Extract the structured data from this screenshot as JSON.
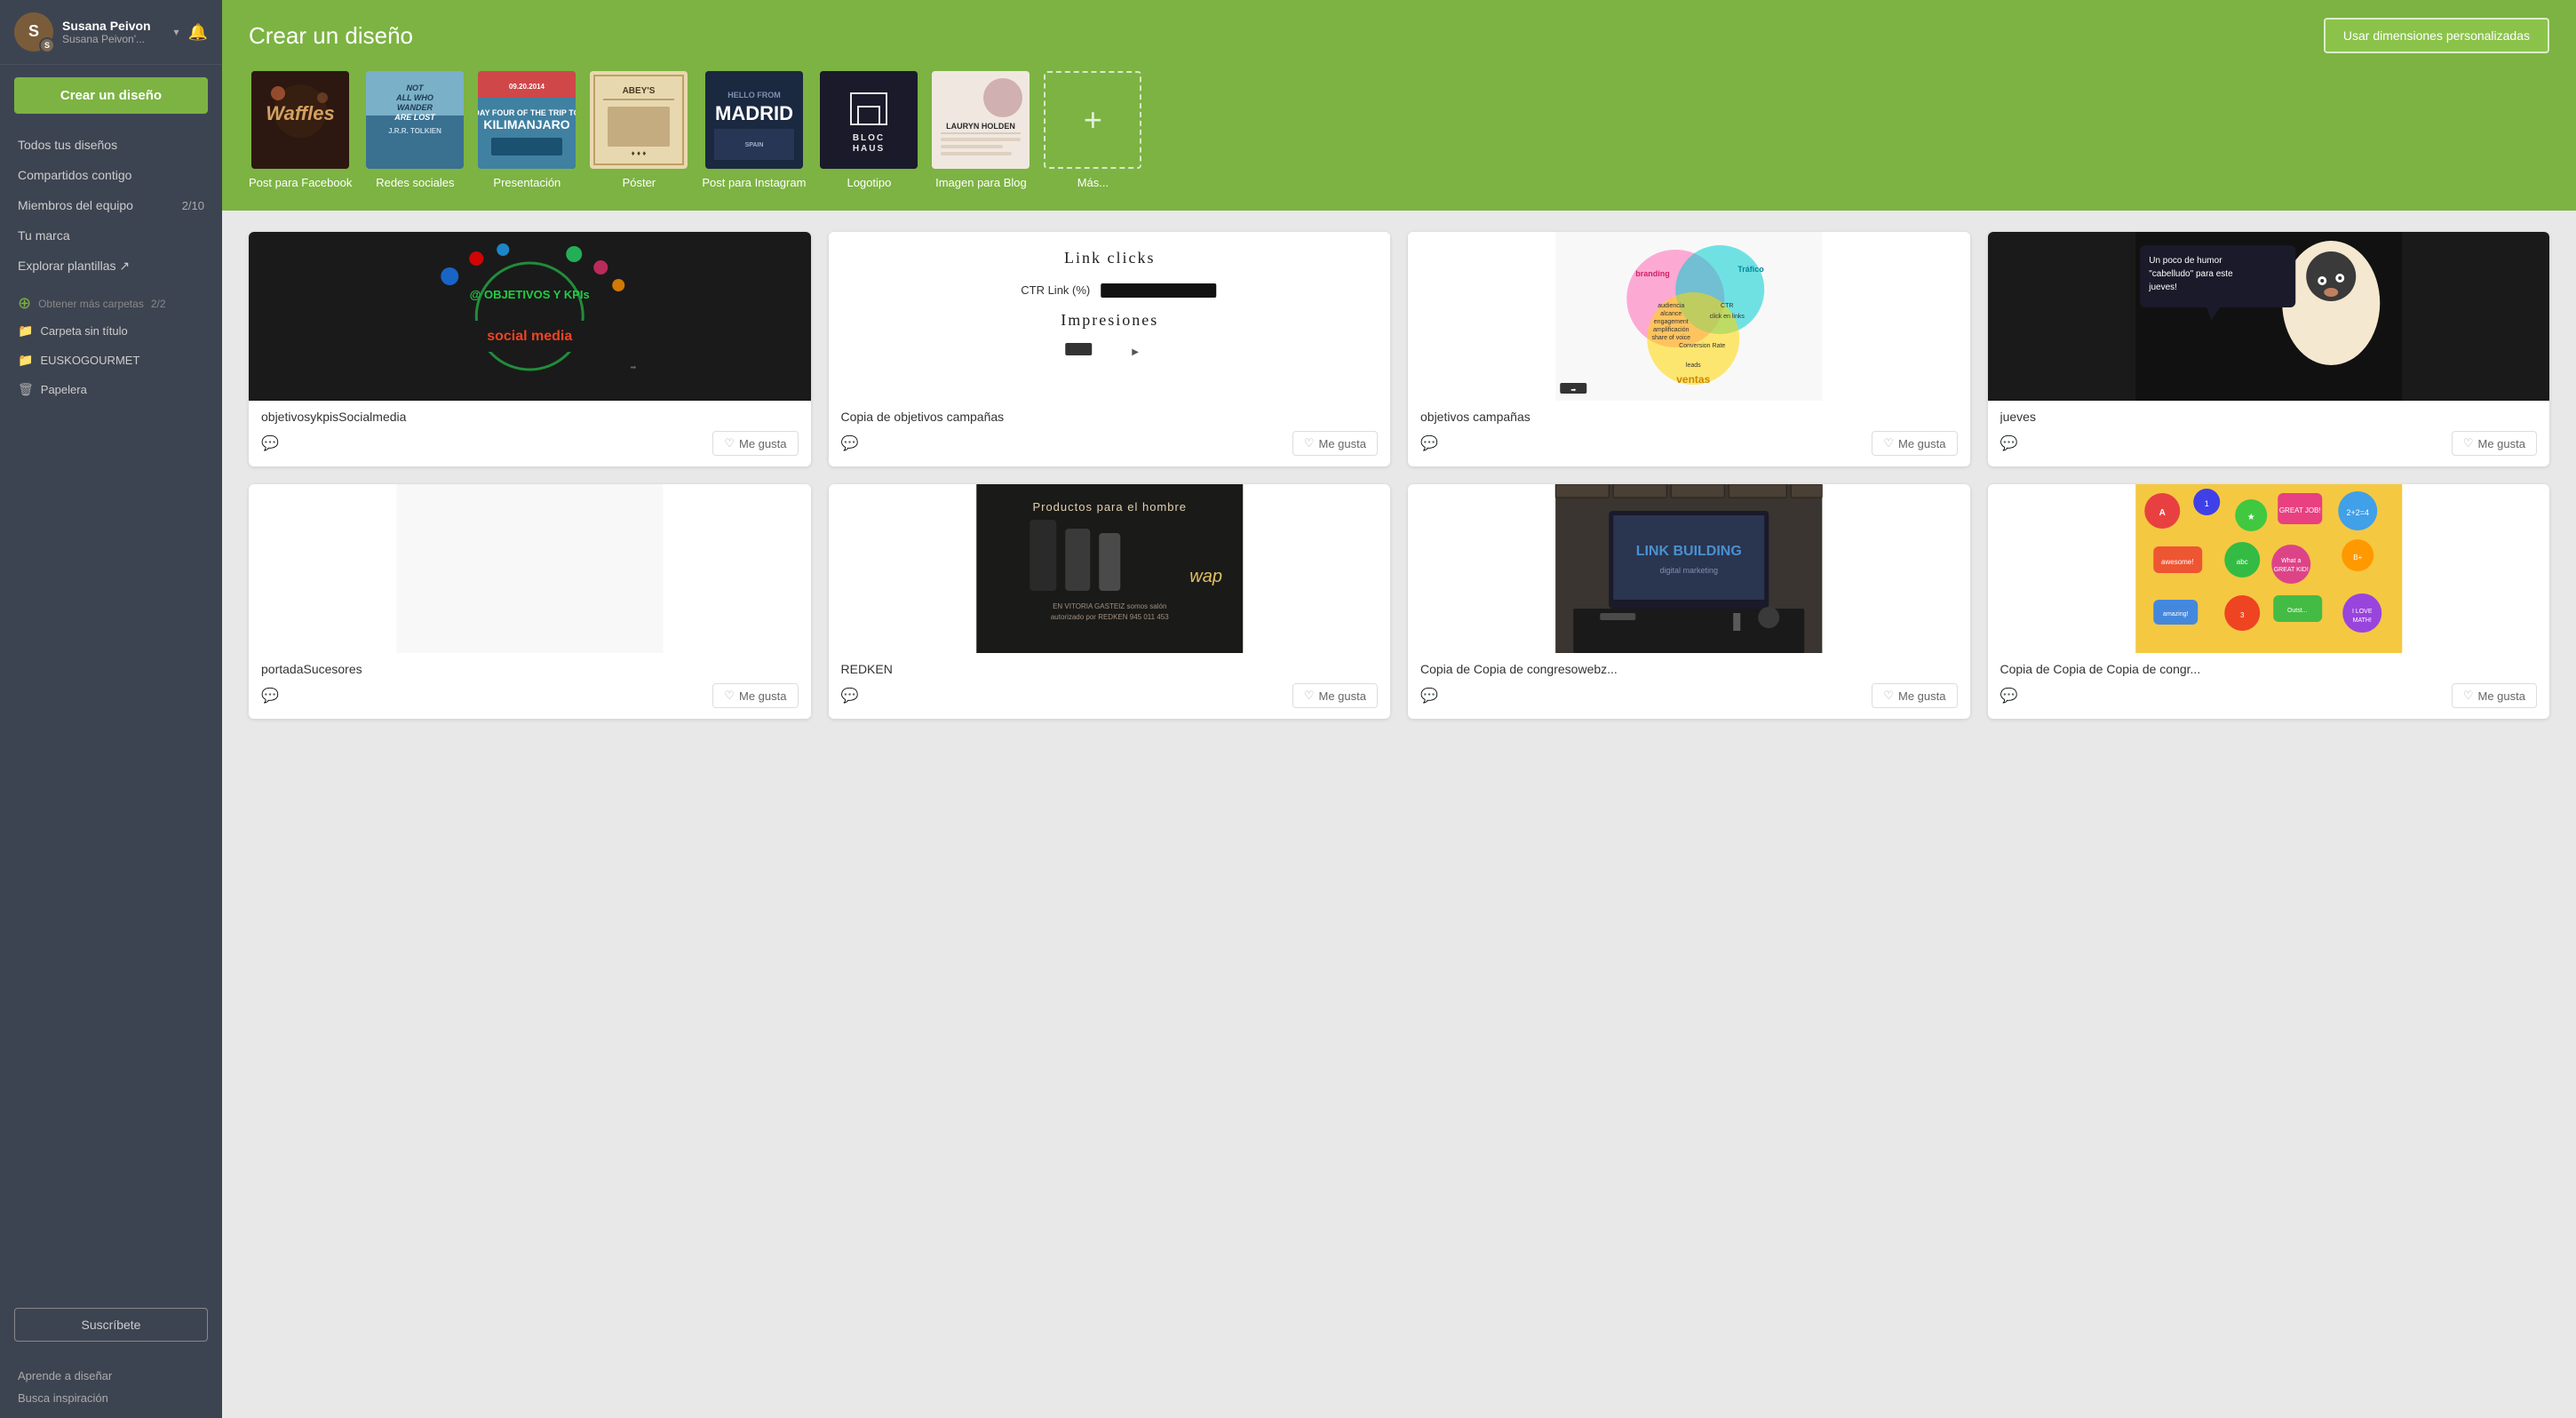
{
  "sidebar": {
    "user": {
      "name": "Susana Peivon",
      "sub": "Susana Peivon'...",
      "avatar_letter": "S"
    },
    "create_label": "Crear un diseño",
    "nav_items": [
      {
        "id": "all-designs",
        "label": "Todos tus diseños",
        "count": null,
        "badge": null
      },
      {
        "id": "shared",
        "label": "Compartidos contigo",
        "count": null,
        "badge": null
      },
      {
        "id": "team-members",
        "label": "Miembros del equipo",
        "count": "2/10",
        "badge": null
      },
      {
        "id": "brand",
        "label": "Tu marca",
        "count": null,
        "badge": null
      },
      {
        "id": "explore",
        "label": "Explorar plantillas ↗",
        "count": null,
        "badge": null
      }
    ],
    "folders_section_label": "Obtener más carpetas",
    "folders_badge": "2/2",
    "folders": [
      {
        "id": "untitled",
        "label": "Carpeta sin título",
        "icon": "folder"
      },
      {
        "id": "euskogourmet",
        "label": "EUSKOGOURMET",
        "icon": "folder"
      },
      {
        "id": "trash",
        "label": "Papelera",
        "icon": "trash"
      }
    ],
    "subscribe_label": "Suscríbete",
    "bottom_links": [
      {
        "id": "learn",
        "label": "Aprende a diseñar"
      },
      {
        "id": "inspiration",
        "label": "Busca inspiración"
      }
    ]
  },
  "header": {
    "title": "Crear un diseño",
    "custom_btn": "Usar dimensiones personalizadas"
  },
  "design_types": [
    {
      "id": "facebook",
      "label": "Post para Facebook",
      "bg": "facebook"
    },
    {
      "id": "social",
      "label": "Redes sociales",
      "bg": "social"
    },
    {
      "id": "presentation",
      "label": "Presentación",
      "bg": "presentation"
    },
    {
      "id": "poster",
      "label": "Póster",
      "bg": "poster"
    },
    {
      "id": "instagram",
      "label": "Post para Instagram",
      "bg": "instagram"
    },
    {
      "id": "logo",
      "label": "Logotipo",
      "bg": "logo"
    },
    {
      "id": "blog",
      "label": "Imagen para Blog",
      "bg": "blog"
    },
    {
      "id": "more",
      "label": "Más...",
      "bg": "more"
    }
  ],
  "designs": [
    {
      "id": "d1",
      "title": "objetivosykpisSocialmedia",
      "bg": "dark",
      "like_label": "Me gusta",
      "row": 1,
      "col": 1
    },
    {
      "id": "d2",
      "title": "Copia de objetivos campañas",
      "bg": "white-chart",
      "like_label": "Me gusta",
      "row": 1,
      "col": 2
    },
    {
      "id": "d3",
      "title": "objetivos campañas",
      "bg": "venn",
      "like_label": "Me gusta",
      "row": 1,
      "col": 3
    },
    {
      "id": "d4",
      "title": "jueves",
      "bg": "dark-humor",
      "like_label": "Me gusta",
      "row": 1,
      "col": 4
    },
    {
      "id": "d5",
      "title": "portadaSucesores",
      "bg": "white-empty",
      "like_label": "Me gusta",
      "row": 2,
      "col": 1
    },
    {
      "id": "d6",
      "title": "REDKEN",
      "bg": "redken",
      "like_label": "Me gusta",
      "row": 2,
      "col": 2
    },
    {
      "id": "d7",
      "title": "Copia de Copia de congresowebz...",
      "bg": "link-building",
      "like_label": "Me gusta",
      "row": 2,
      "col": 3
    },
    {
      "id": "d8",
      "title": "Copia de Copia de Copia de congr...",
      "bg": "education",
      "like_label": "Me gusta",
      "row": 2,
      "col": 4
    }
  ],
  "colors": {
    "sidebar_bg": "#3d4451",
    "green": "#7cb342",
    "dark": "#1a1a1a"
  }
}
